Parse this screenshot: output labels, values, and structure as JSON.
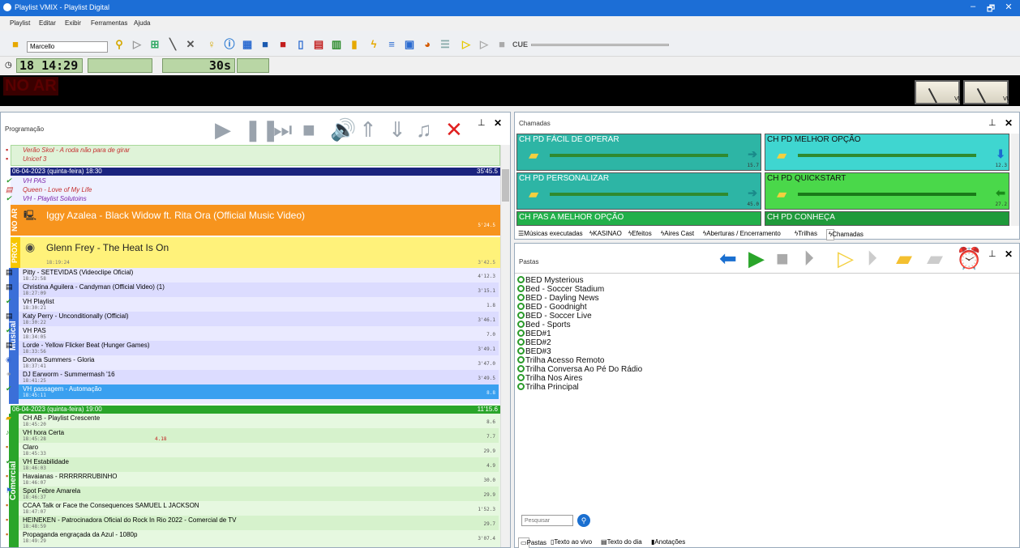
{
  "window": {
    "title": "Playlist VMIX - Playlist Digital",
    "minimize": "–",
    "restore": "🗗",
    "close": "✕"
  },
  "menu": [
    "Playlist",
    "Editar",
    "Exibir",
    "Ferramentas",
    "Ajuda"
  ],
  "toolbar": {
    "user": "Marcello",
    "cue_label": "CUE"
  },
  "clock": {
    "time": "18 14:29",
    "elapsed": "30s"
  },
  "status": {
    "on_air": "NO AR",
    "vu_label": "VU"
  },
  "programacao": {
    "title": "Programação",
    "top_items": [
      "Verão Skol - A roda não para de girar",
      "Unicef 3"
    ],
    "block1": {
      "header": "06-04-2023 (quinta-feira) 18:30",
      "duration": "35'45.5"
    },
    "block1_top": [
      "VH PAS",
      "Queen - Love of My Life",
      "VH - Playlist Solutoins"
    ],
    "now": {
      "label": "NO AR",
      "title": "Iggy Azalea - Black Widow ft. Rita Ora (Official Music Video)",
      "duration": "5'24.5"
    },
    "next": {
      "label": "PROX",
      "title": "Glenn Frey - The Heat Is On",
      "time": "18:19:24",
      "duration": "3'42.5"
    },
    "side_musical": "Musical",
    "musical_items": [
      {
        "title": "Pitty - SETEVIDAS (Videoclipe Oficial)",
        "time": "18:22:58",
        "dur": "4'12.3"
      },
      {
        "title": "Christina Aguilera - Candyman (Official Video) (1)",
        "time": "18:27:09",
        "dur": "3'15.1"
      },
      {
        "title": "VH Playlist",
        "time": "18:30:21",
        "dur": "1.8"
      },
      {
        "title": "Katy Perry - Unconditionally (Official)",
        "time": "18:30:22",
        "dur": "3'46.1"
      },
      {
        "title": "VH PAS",
        "time": "18:34:05",
        "dur": "7.0"
      },
      {
        "title": "Lorde - Yellow Flicker Beat (Hunger Games)",
        "time": "18:33:56",
        "dur": "3'49.1"
      },
      {
        "title": "Donna Summers - Gloria",
        "time": "18:37:41",
        "dur": "3'47.0"
      },
      {
        "title": "DJ Earworm - Summermash '16",
        "time": "18:41:25",
        "dur": "3'49.5"
      },
      {
        "title": "VH passagem - Automação",
        "time": "18:45:11",
        "dur": "8.8"
      }
    ],
    "block2": {
      "header": "06-04-2023 (quinta-feira) 19:00",
      "duration": "11'15.6"
    },
    "side_comercial": "Comercial",
    "comercial_items": [
      {
        "title": "CH AB - Playlist Crescente",
        "time": "18:45:20",
        "dur": "8.6"
      },
      {
        "title": "VH hora Certa",
        "time": "18:45:28",
        "dur": "7.7",
        "extra": "4.18"
      },
      {
        "title": "Claro",
        "time": "18:45:33",
        "dur": "29.9"
      },
      {
        "title": "VH Estabilidade",
        "time": "18:46:03",
        "dur": "4.9"
      },
      {
        "title": "Havaianas - RRRRRRRUBINHO",
        "time": "18:46:07",
        "dur": "30.0"
      },
      {
        "title": "Spot Febre Amarela",
        "time": "18:46:37",
        "dur": "29.9"
      },
      {
        "title": "CCAA Talk or Face the Consequences SAMUEL L JACKSON",
        "time": "18:47:07",
        "dur": "1'52.3"
      },
      {
        "title": "HEINEKEN - Patrocinadora Oficial do Rock In Rio 2022 - Comercial de TV",
        "time": "18:48:59",
        "dur": "29.7"
      },
      {
        "title": "Propaganda engraçada da Azul - 1080p",
        "time": "18:49:29",
        "dur": "3'07.4"
      }
    ]
  },
  "chamadas": {
    "title": "Chamadas",
    "tiles": [
      {
        "label": "CH PD FÁCIL DE OPERAR",
        "value": "15.7",
        "color": "#2db5a5"
      },
      {
        "label": "CH PD MELHOR OPÇÃO",
        "value": "12.3",
        "color": "#3fd6d0"
      },
      {
        "label": "CH PD PERSONALIZAR",
        "value": "45.0",
        "color": "#2db5a5"
      },
      {
        "label": "CH PD QUICKSTART",
        "value": "27.2",
        "color": "#4ad84a"
      },
      {
        "label": "CH PAS A MELHOR OPÇÃO",
        "value": "",
        "color": "#22b04a"
      },
      {
        "label": "CH PD CONHEÇA",
        "value": "",
        "color": "#1f9a3a"
      }
    ],
    "tabs": [
      "Músicas executadas",
      "KASINAO",
      "Efeitos",
      "Aires Cast",
      "Aberturas / Encerramento",
      "Trilhas",
      "Chamadas"
    ]
  },
  "pastas": {
    "title": "Pastas",
    "items": [
      "BED Mysterious",
      "Bed - Soccer Stadium",
      "BED - Dayling News",
      "BED - Goodnight",
      "BED - Soccer Live",
      "Bed - Sports",
      "BED#1",
      "BED#2",
      "BED#3",
      "Trilha Acesso Remoto",
      "Trilha Conversa Ao Pé Do Rádio",
      "Trilha Nos Aires",
      "Trilha Principal"
    ],
    "search_placeholder": "Pesquisar",
    "bottom_tabs": [
      "Pastas",
      "Texto ao vivo",
      "Texto do dia",
      "Anotações"
    ]
  }
}
